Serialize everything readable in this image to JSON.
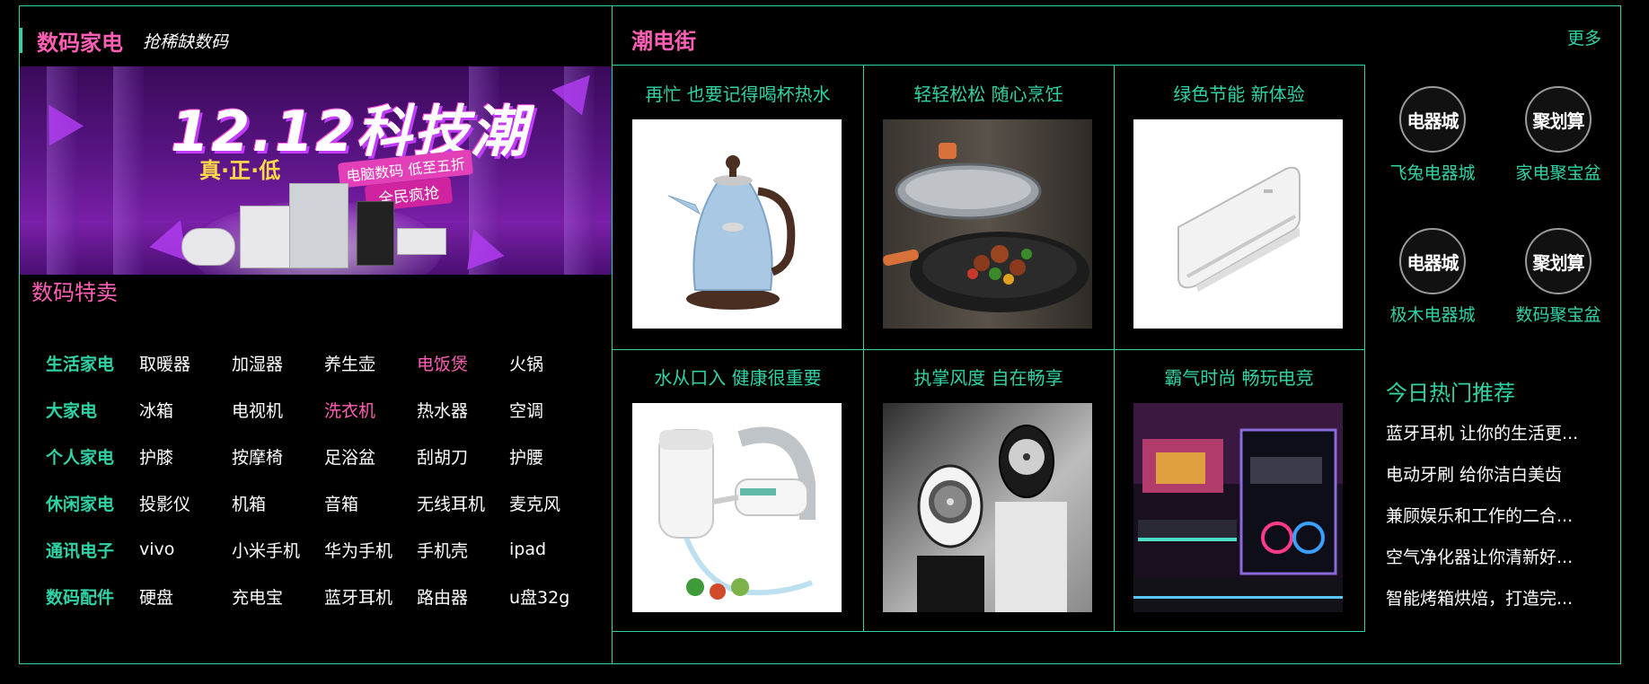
{
  "left": {
    "title": "数码家电",
    "subtitle": "抢稀缺数码",
    "banner": {
      "headline": "12.12科技潮",
      "slogan": "真·正·低",
      "tag1": "电脑数码 低至五折",
      "tag2": "全民疯抢"
    },
    "hot_title": "数码特卖",
    "categories": [
      {
        "head": "生活家电",
        "items": [
          "取暖器",
          "加湿器",
          "养生壶",
          "电饭煲",
          "火锅"
        ]
      },
      {
        "head": "大家电",
        "items": [
          "冰箱",
          "电视机",
          "洗衣机",
          "热水器",
          "空调"
        ]
      },
      {
        "head": "个人家电",
        "items": [
          "护膝",
          "按摩椅",
          "足浴盆",
          "刮胡刀",
          "护腰"
        ]
      },
      {
        "head": "休闲家电",
        "items": [
          "投影仪",
          "机箱",
          "音箱",
          "无线耳机",
          "麦克风"
        ]
      },
      {
        "head": "通讯电子",
        "items": [
          "vivo",
          "小米手机",
          "华为手机",
          "手机壳",
          "ipad"
        ]
      },
      {
        "head": "数码配件",
        "items": [
          "硬盘",
          "充电宝",
          "蓝牙耳机",
          "路由器",
          "u盘32g"
        ]
      }
    ]
  },
  "right": {
    "title": "潮电街",
    "more": "更多",
    "products": [
      {
        "title": "再忙 也要记得喝杯热水"
      },
      {
        "title": "轻轻松松 随心烹饪"
      },
      {
        "title": "绿色节能 新体验"
      },
      {
        "title": "水从口入 健康很重要"
      },
      {
        "title": "执掌风度 自在畅享"
      },
      {
        "title": "霸气时尚 畅玩电竞"
      }
    ],
    "stores": [
      {
        "logo": "电器城",
        "name": "飞兔电器城"
      },
      {
        "logo": "聚划算",
        "name": "家电聚宝盆"
      },
      {
        "logo": "电器城",
        "name": "极木电器城"
      },
      {
        "logo": "聚划算",
        "name": "数码聚宝盆"
      }
    ],
    "today_title": "今日热门推荐",
    "today": [
      "蓝牙耳机 让你的生活更...",
      "电动牙刷 给你洁白美齿",
      "兼顾娱乐和工作的二合...",
      "空气净化器让你清新好...",
      "智能烤箱烘焙，打造完..."
    ]
  },
  "colors": {
    "accent": "#2fd3a6",
    "pink": "#ff5fb4",
    "background": "#000000"
  }
}
